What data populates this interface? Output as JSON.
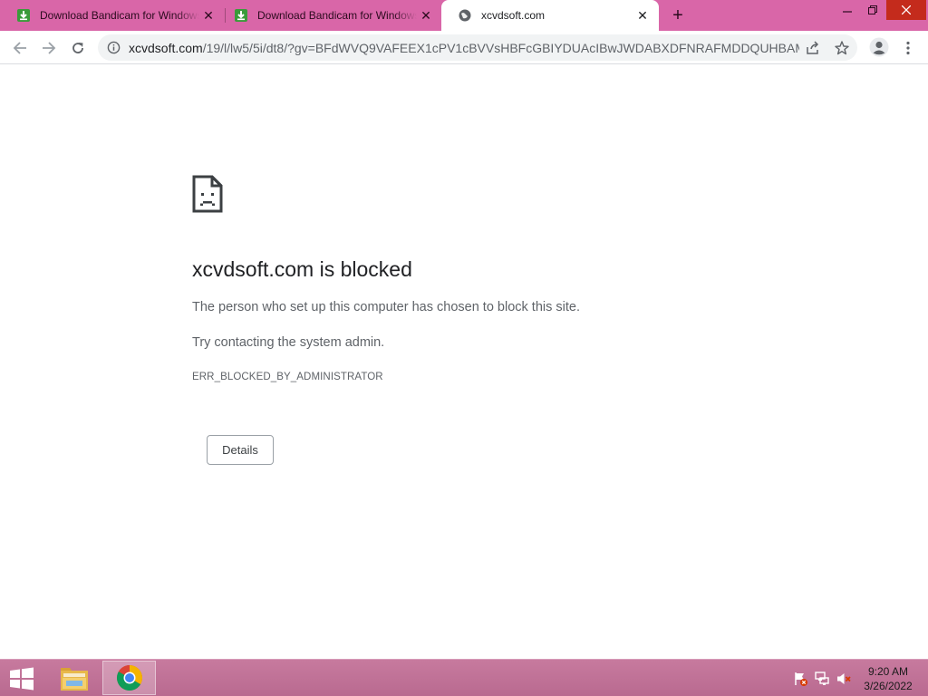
{
  "tabs": [
    {
      "title": "Download Bandicam for Windows",
      "favicon": "download-icon",
      "active": false
    },
    {
      "title": "Download Bandicam for Windows",
      "favicon": "download-icon",
      "active": false
    },
    {
      "title": "xcvdsoft.com",
      "favicon": "globe-icon",
      "active": true
    }
  ],
  "omnibox": {
    "host": "xcvdsoft.com",
    "path": "/19/l/lw5/5i/dt8/?gv=BFdWVQ9VAFEEX1cPV1cBVVsHBFcGBIYDUAcIBwJWDABXDFNRAFMDDQUHBAMA..."
  },
  "error": {
    "title": "xcvdsoft.com is blocked",
    "message": "The person who set up this computer has chosen to block this site.",
    "suggestion": "Try contacting the system admin.",
    "code": "ERR_BLOCKED_BY_ADMINISTRATOR",
    "details_label": "Details"
  },
  "taskbar": {
    "time": "9:20 AM",
    "date": "3/26/2022"
  },
  "colors": {
    "tabstrip": "#d966a8",
    "taskbar": "#c77a9e",
    "text_primary": "#202124",
    "text_secondary": "#5f6368"
  }
}
